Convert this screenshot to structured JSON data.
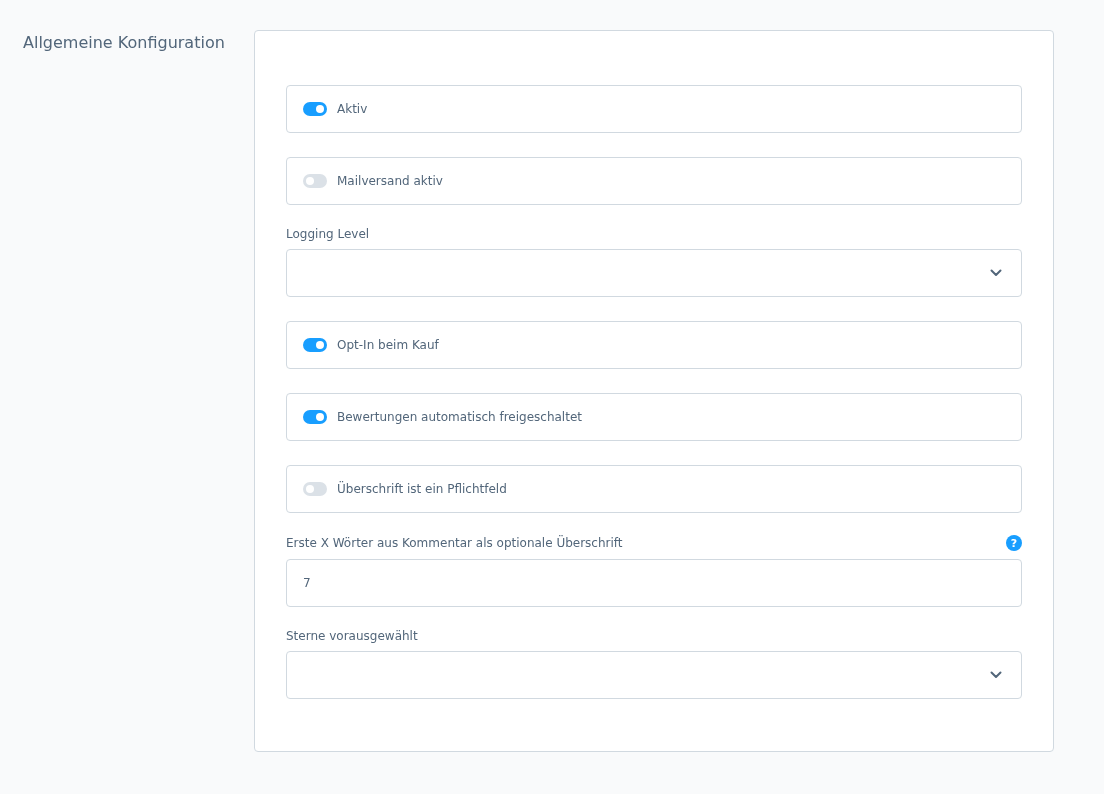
{
  "section_title": "Allgemeine Konfiguration",
  "fields": [
    {
      "kind": "toggle",
      "label": "Aktiv",
      "on": true
    },
    {
      "kind": "toggle",
      "label": "Mailversand aktiv",
      "on": false
    },
    {
      "kind": "select",
      "label": "Logging Level"
    },
    {
      "kind": "toggle",
      "label": "Opt-In beim Kauf",
      "on": true
    },
    {
      "kind": "toggle",
      "label": "Bewertungen automatisch freigeschaltet",
      "on": true
    },
    {
      "kind": "toggle",
      "label": "Überschrift ist ein Pflichtfeld",
      "on": false
    },
    {
      "kind": "number",
      "label": "Erste X Wörter aus Kommentar als optionale Überschrift",
      "help": "?",
      "value": "7"
    },
    {
      "kind": "select",
      "label": "Sterne vorausgewählt"
    }
  ]
}
